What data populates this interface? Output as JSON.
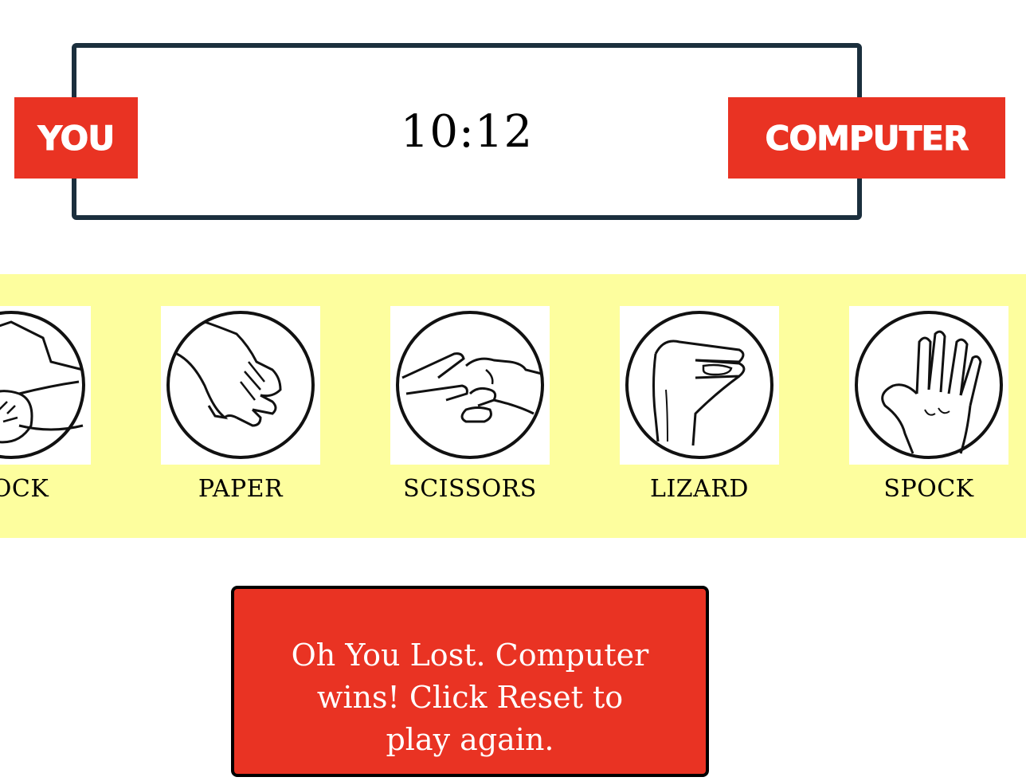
{
  "scoreboard": {
    "you_label": "YOU",
    "computer_label": "COMPUTER",
    "score": "10:12"
  },
  "choices": [
    {
      "label": "ROCK",
      "icon": "rock-hand-icon"
    },
    {
      "label": "PAPER",
      "icon": "paper-hand-icon"
    },
    {
      "label": "SCISSORS",
      "icon": "scissors-hand-icon"
    },
    {
      "label": "LIZARD",
      "icon": "lizard-hand-icon"
    },
    {
      "label": "SPOCK",
      "icon": "spock-hand-icon"
    }
  ],
  "result": {
    "message": "Oh You Lost. Computer wins! Click Reset to play again."
  },
  "colors": {
    "accent_red": "#e93323",
    "board_border": "#1b2f3d",
    "strip_background": "#fdfe9e"
  }
}
